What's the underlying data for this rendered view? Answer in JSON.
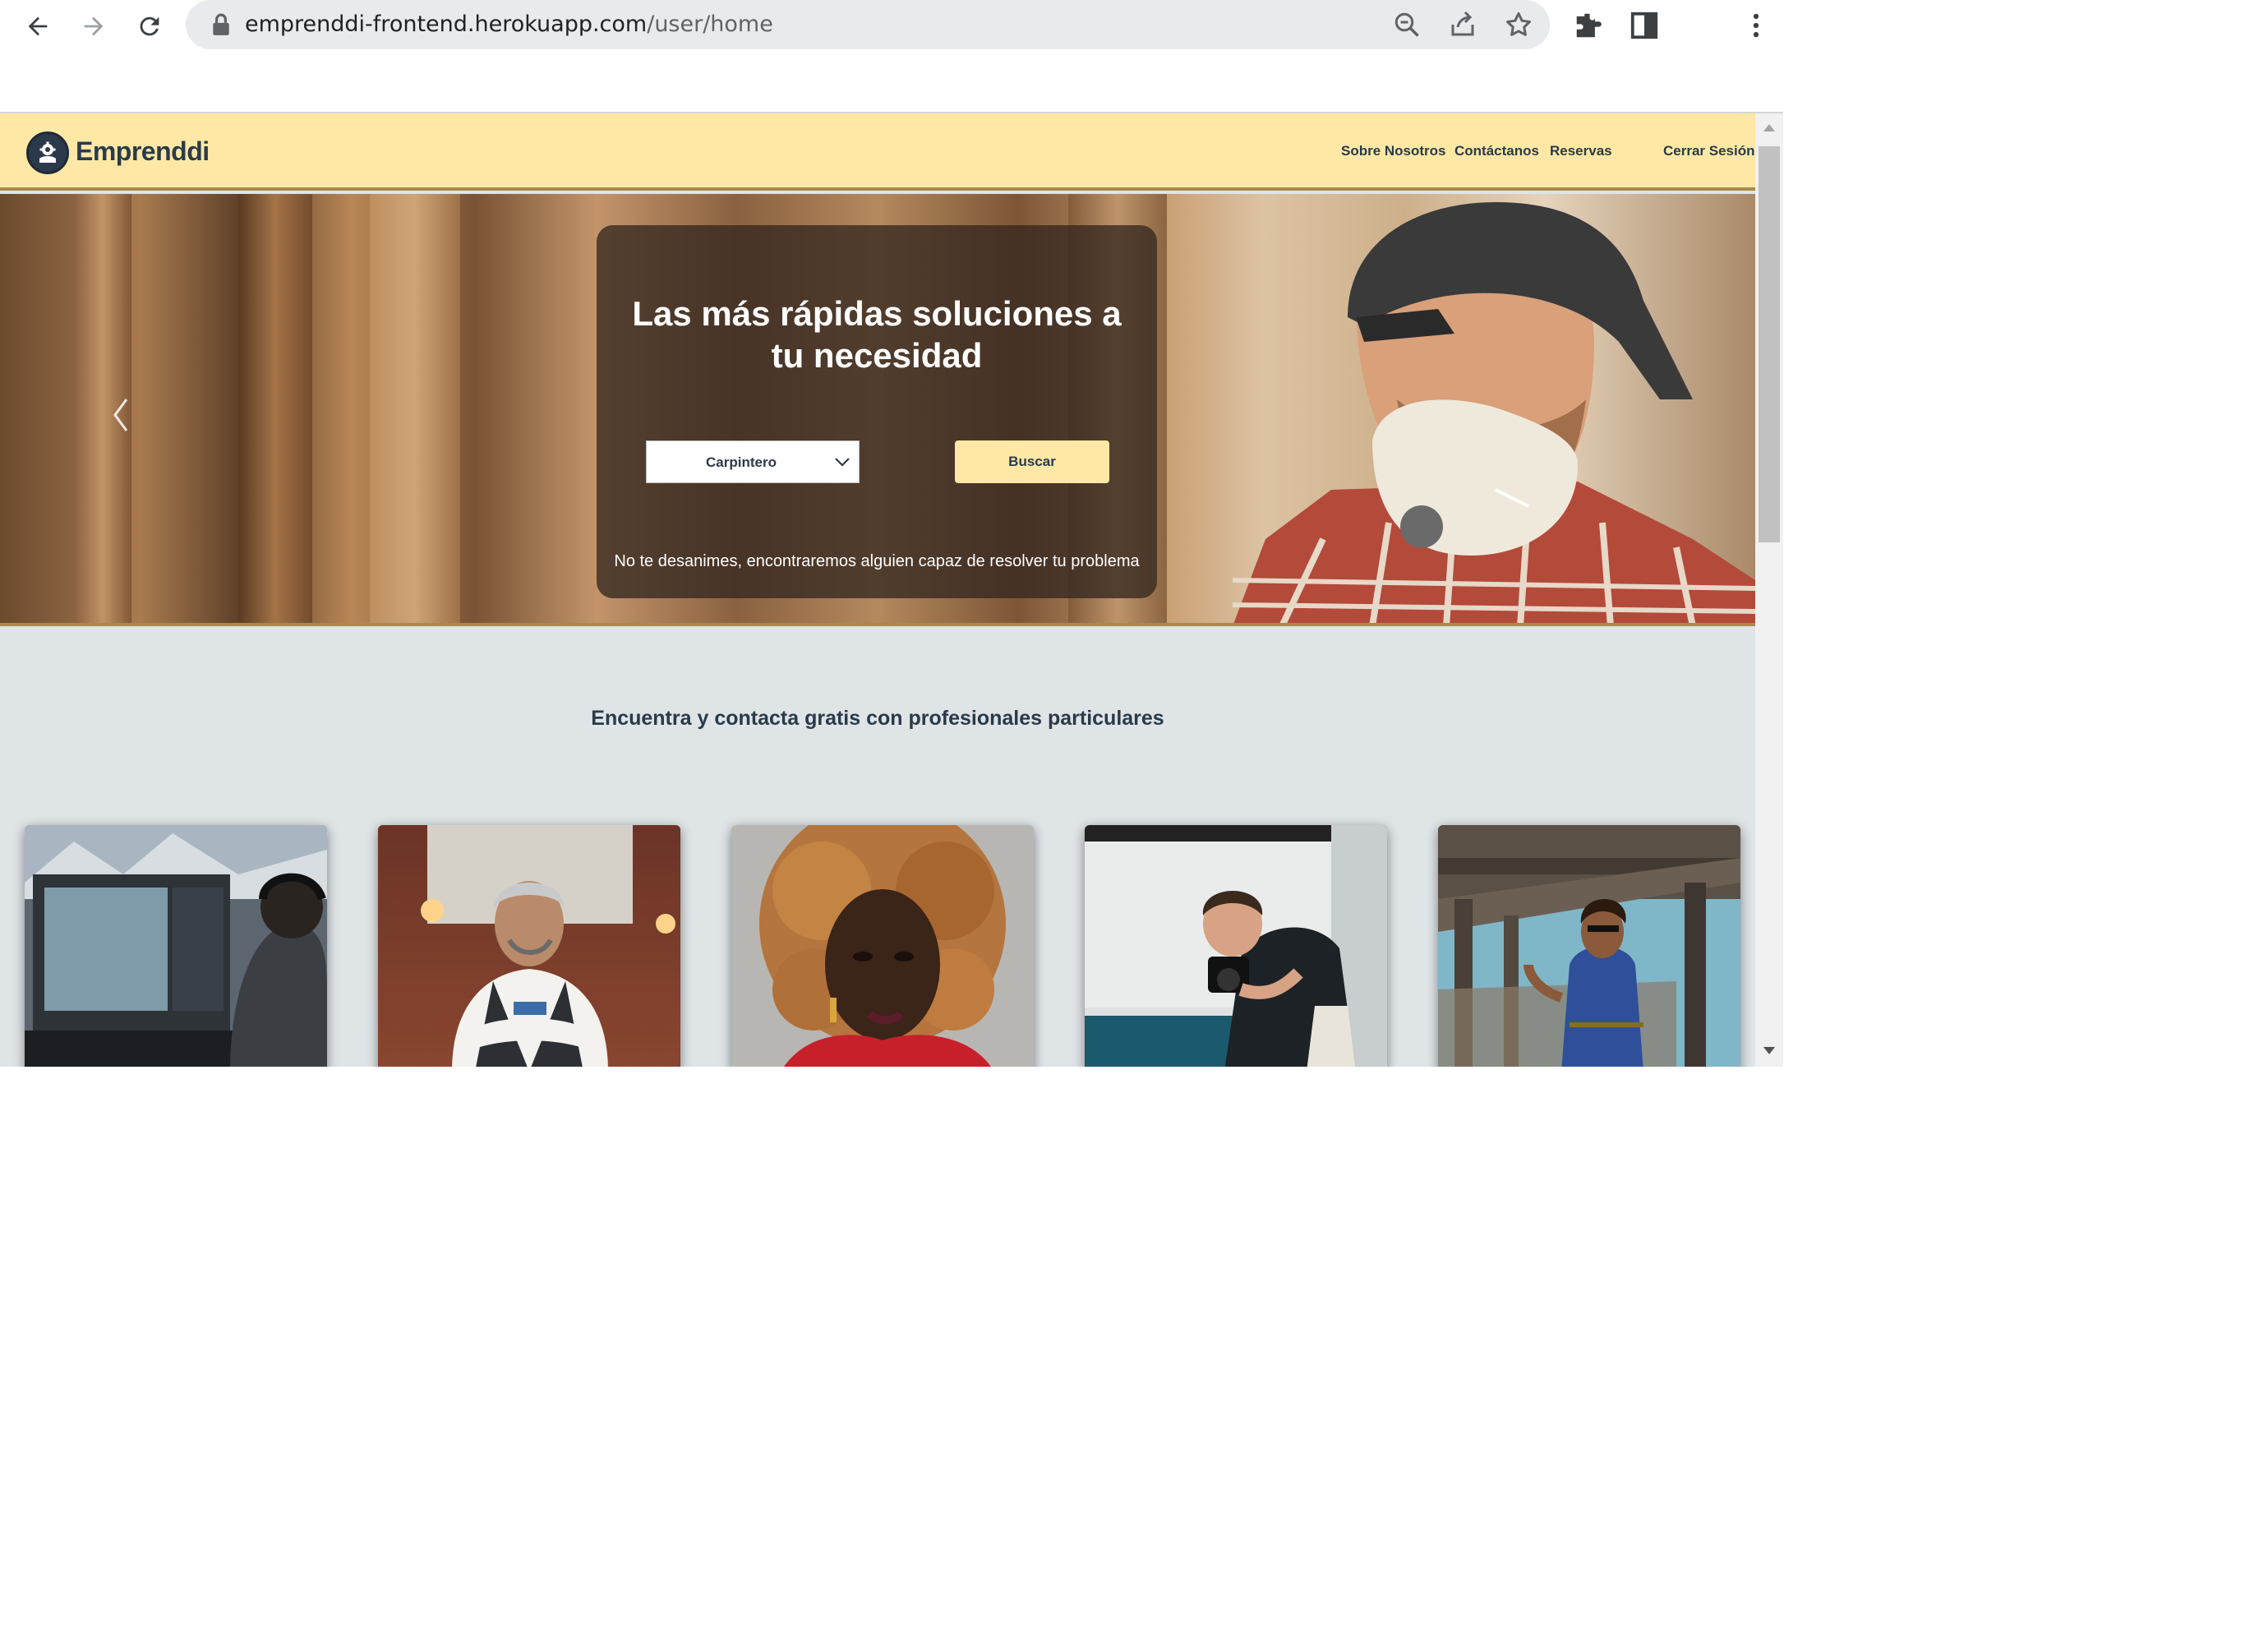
{
  "browser": {
    "url_host": "emprenddi-frontend.herokuapp.com",
    "url_path": "/user/home"
  },
  "site": {
    "brand": "Emprenddi",
    "nav": {
      "about": "Sobre Nosotros",
      "contact": "Contáctanos",
      "bookings": "Reservas",
      "logout": "Cerrar Sesión"
    }
  },
  "hero": {
    "title": "Las más rápidas soluciones a tu necesidad",
    "category_selected": "Carpintero",
    "search_label": "Buscar",
    "subtext": "No te desanimes, encontraremos alguien capaz de resolver tu problema"
  },
  "section": {
    "heading": "Encuentra y contacta gratis con profesionales particulares"
  },
  "colors": {
    "accent": "#ffe8a5",
    "text_dark": "#2b3a4a",
    "page_bg": "#dfe4e7"
  },
  "icons": {
    "back": "arrow-left-icon",
    "forward": "arrow-right-icon",
    "reload": "reload-icon",
    "lock": "lock-icon",
    "zoom": "zoom-icon",
    "share": "share-icon",
    "bookmark": "star-icon",
    "extensions": "puzzle-icon",
    "side_panel": "side-panel-icon",
    "menu": "kebab-menu-icon",
    "carousel_prev": "chevron-left-icon",
    "select_arrow": "chevron-down-icon"
  }
}
